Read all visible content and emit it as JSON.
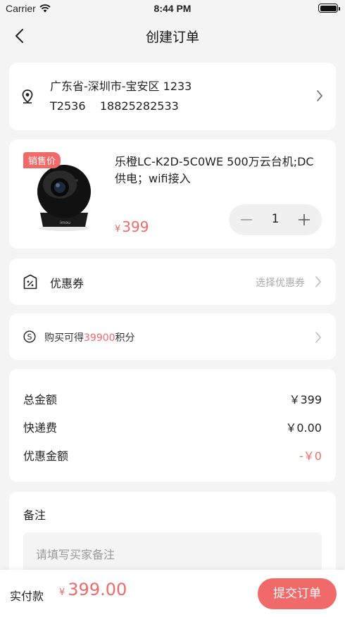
{
  "status_bar": {
    "carrier": "Carrier",
    "time": "8:44 PM"
  },
  "nav": {
    "title": "创建订单"
  },
  "address": {
    "line1": "广东省-深圳市-宝安区 1233",
    "name": "T2536",
    "phone": "18825282533"
  },
  "product": {
    "badge": "销售价",
    "name": "乐橙LC-K2D-5C0WE 500万云台机;DC供电；wifi接入",
    "currency": "¥",
    "price": "399",
    "quantity": "1",
    "camera_brand": "imou"
  },
  "coupon": {
    "label": "优惠券",
    "action": "选择优惠券"
  },
  "points": {
    "prefix": "购买可得",
    "amount": "39900",
    "suffix": "积分"
  },
  "summary": {
    "total_label": "总金额",
    "total_value": "￥399",
    "shipping_label": "快递费",
    "shipping_value": "￥0.00",
    "discount_label": "优惠金额",
    "discount_value": "-￥0"
  },
  "remark": {
    "title": "备注",
    "placeholder": "请填写买家备注"
  },
  "footer": {
    "pay_label": "实付款",
    "currency": "¥",
    "pay_amount": "399.00",
    "submit_label": "提交订单"
  },
  "colors": {
    "accent": "#f06a6a",
    "background": "#f4f4f4",
    "card": "#ffffff"
  }
}
